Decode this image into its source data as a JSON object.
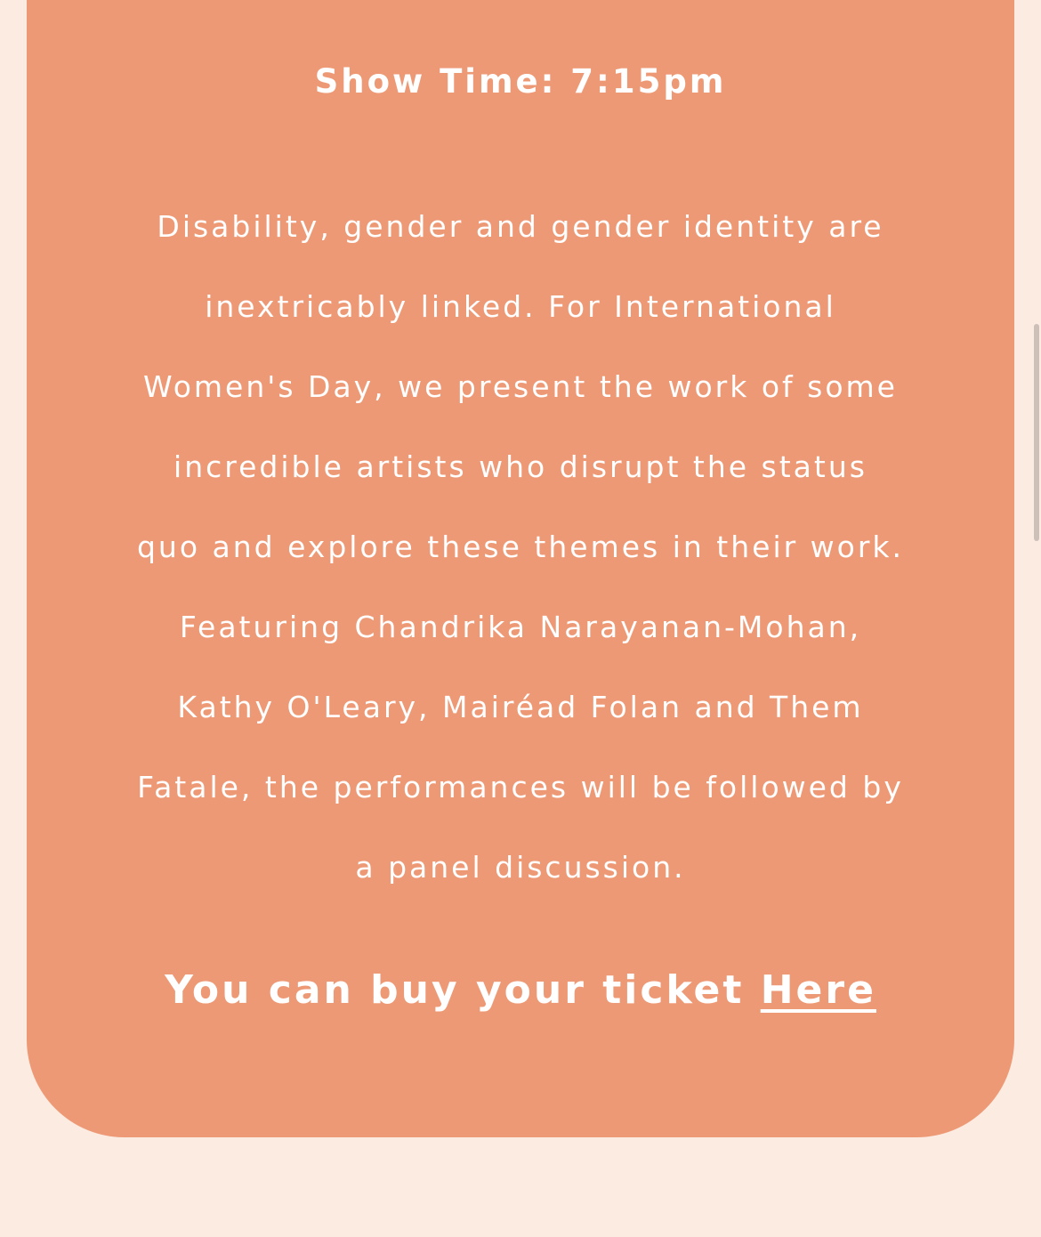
{
  "event": {
    "show_time": "Show Time: 7:15pm",
    "description_lines": [
      "Disability, gender and gender identity are",
      "inextricably linked. For International",
      "Women's Day, we present the work of some",
      "incredible artists who disrupt the status",
      "quo and explore these themes in their work.",
      "Featuring Chandrika Narayanan-Mohan,",
      "Kathy O'Leary, Mairéad Folan and Them",
      "Fatale, the performances will be followed by",
      "a panel discussion."
    ],
    "ticket_text": "You can buy your ticket ",
    "ticket_link_label": "Here"
  },
  "colors": {
    "page_background": "#FBEBE1",
    "card_background": "#EE9975",
    "text": "#FFFFFF"
  }
}
